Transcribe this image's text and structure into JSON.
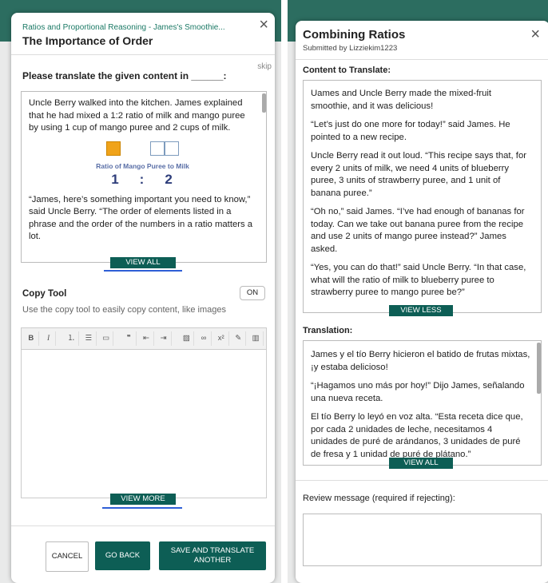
{
  "colors": {
    "accent": "#0d5e55",
    "subtitle": "#1c7a66",
    "underline": "#2f5fd6"
  },
  "left": {
    "subtitle": "Ratios and Proportional Reasoning - James's Smoothie...",
    "title": "The Importance of Order",
    "close_icon": "×",
    "skip": "skip",
    "prompt": "Please translate the given content in ______:",
    "content": {
      "p1": "Uncle Berry walked into the kitchen. James explained that he had mixed a 1:2 ratio of milk and mango puree by using 1 cup of mango puree and 2 cups of milk.",
      "ratio_label": "Ratio of Mango Puree to Milk",
      "ratio_left": "1",
      "ratio_sep": ":",
      "ratio_right": "2",
      "p2": "“James, here’s something important you need to know,” said Uncle Berry. “The order of elements listed in a phrase and the order of the numbers in a ratio matters a lot."
    },
    "view_all": "VIEW ALL",
    "copy_tool": {
      "title": "Copy Tool",
      "toggle": "ON",
      "description": "Use the copy tool to easily copy content, like images"
    },
    "toolbar": {
      "bold": "B",
      "italic": "I",
      "ordered_list": "⒈",
      "bullet_list": "☰",
      "comment": "▭",
      "quote": "❞",
      "indent_dec": "⇤",
      "indent_inc": "⇥",
      "image": "▨",
      "link": "∞",
      "superscript": "x²",
      "edit": "✎",
      "columns": "▥"
    },
    "view_more": "VIEW MORE",
    "buttons": {
      "cancel": "CANCEL",
      "go_back": "GO BACK",
      "save_translate": "SAVE AND TRANSLATE ANOTHER"
    }
  },
  "right": {
    "title": "Combining Ratios",
    "submitted_by": "Submitted by Lizziekim1223",
    "close_icon": "×",
    "content_label": "Content to Translate:",
    "content": {
      "p1": "Uames and Uncle Berry made the mixed-fruit smoothie, and it was delicious!",
      "p2": "“Let’s just do one more for today!” said James. He pointed to a new recipe.",
      "p3": "Uncle Berry read it out loud. “This recipe says that, for every 2 units of milk, we need 4 units of blueberry puree, 3 units of strawberry puree, and 1 unit of banana puree.”",
      "p4": "“Oh no,” said James. “I’ve had enough of bananas for today. Can we take out banana puree from the recipe and use 2 units of mango puree instead?” James asked.",
      "p5": "“Yes, you can do that!” said Uncle Berry. “In that case, what will the ratio of milk to blueberry puree to strawberry puree to mango puree be?”"
    },
    "view_less": "VIEW LESS",
    "translation_label": "Translation:",
    "translation": {
      "p1": "James y el tío Berry hicieron el batido de frutas mixtas, ¡y estaba delicioso!",
      "p2": "“¡Hagamos uno más por hoy!” Dijo James, señalando una nueva receta.",
      "p3": "El tío Berry lo leyó en voz alta. “Esta receta dice que, por cada 2 unidades de leche, necesitamos 4 unidades de puré de arándanos, 3 unidades de puré de fresa y 1 unidad de puré de plátano.”"
    },
    "view_all": "VIEW ALL",
    "review_label": "Review message (required if rejecting):"
  }
}
